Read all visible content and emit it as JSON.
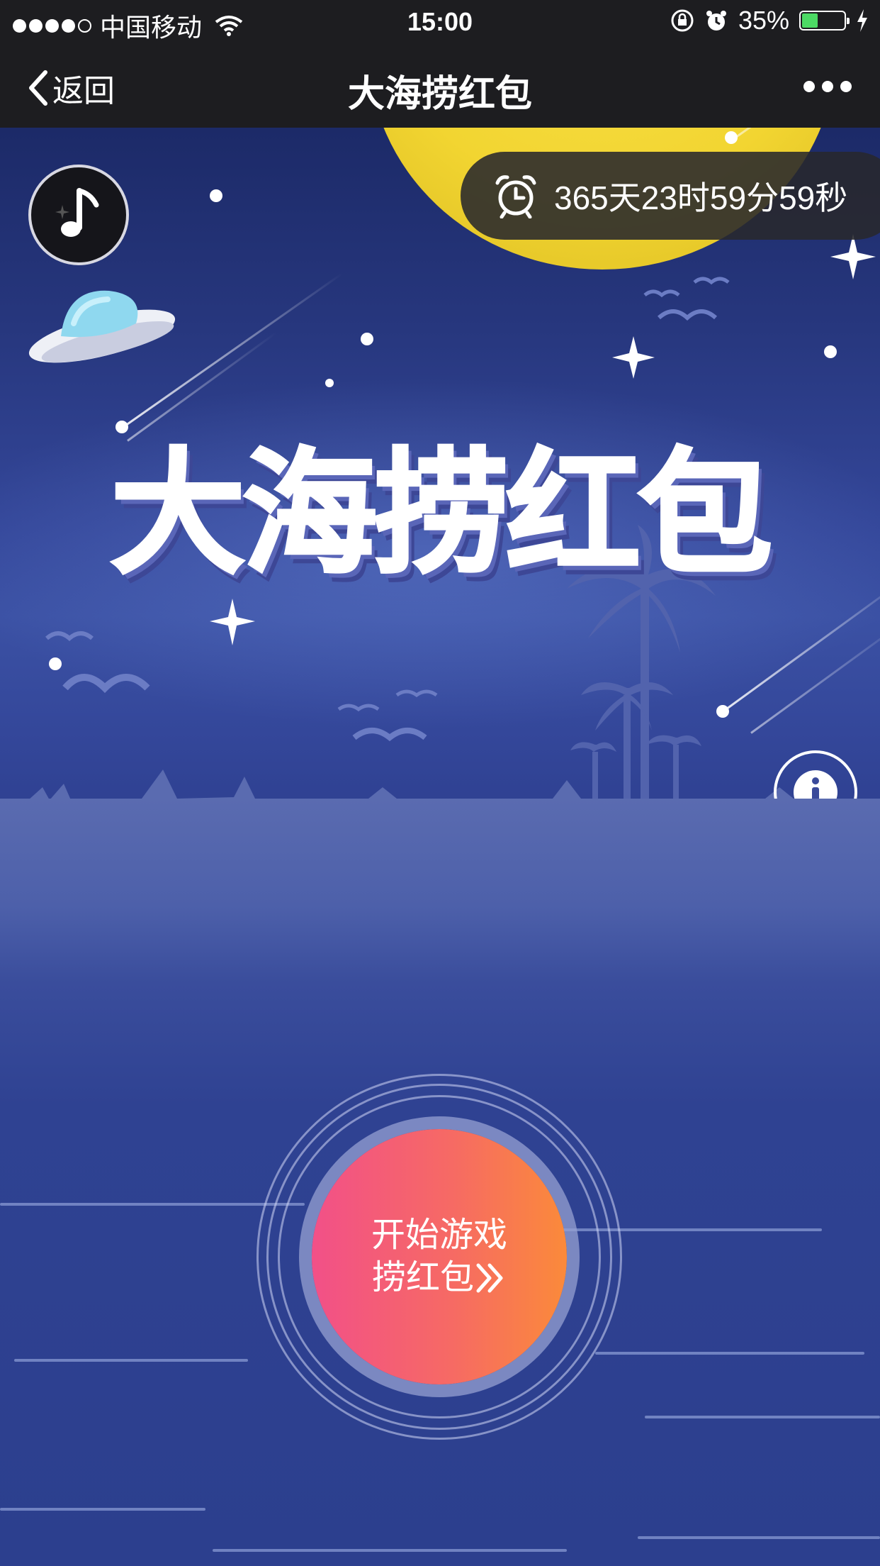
{
  "status_bar": {
    "carrier": "中国移动",
    "time": "15:00",
    "battery_percent": "35%",
    "battery_level": 0.35,
    "signal_bars": 4
  },
  "nav": {
    "back_label": "返回",
    "title": "大海捞红包"
  },
  "timer": {
    "countdown": "365天23时59分59秒"
  },
  "logo_text": "大海捞红包",
  "start_button": {
    "line1": "开始游戏",
    "line2": "捞红包"
  },
  "icons": {
    "music": "music-note-icon",
    "clock": "alarm-clock-icon",
    "info": "info-icon",
    "gift": "gift-icon"
  },
  "colors": {
    "nav_bg": "#1d1d20",
    "sky": "#27377e",
    "sea": "#2f4292",
    "moon": "#f2d531",
    "button_start": "#f25088",
    "button_end": "#fb8a3a"
  }
}
